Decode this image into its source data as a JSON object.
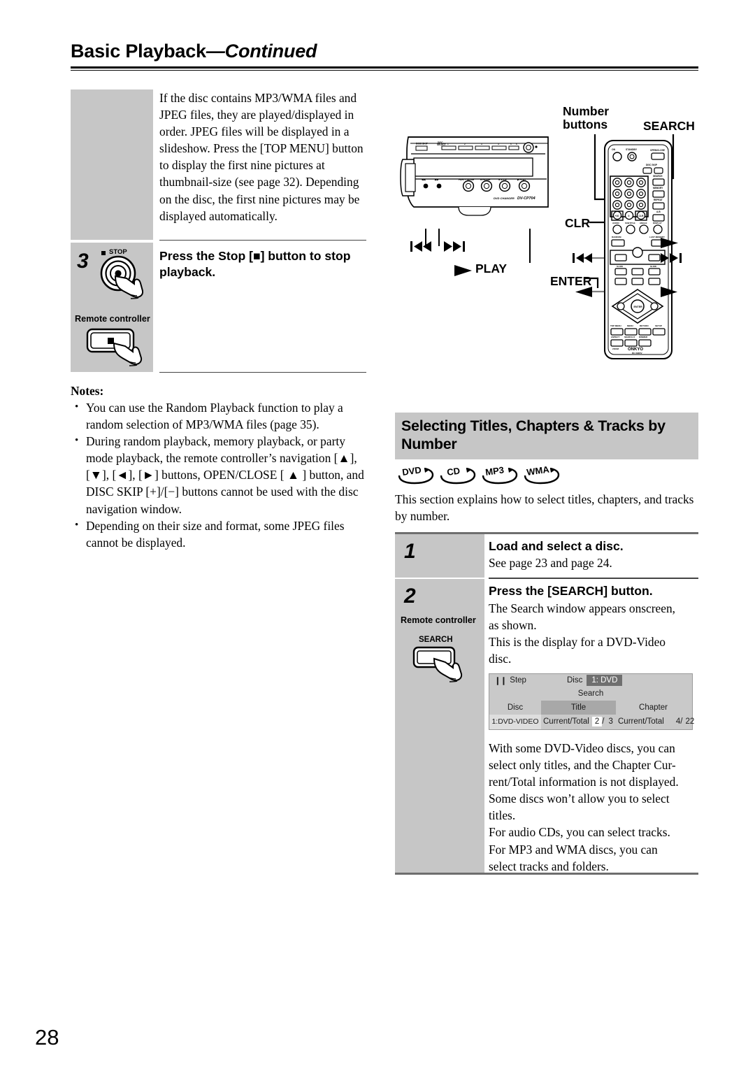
{
  "header": {
    "title_main": "Basic Playback",
    "title_dash": "—",
    "title_cont": "Continued"
  },
  "left_column": {
    "intro_paragraph": "If the disc contains MP3/WMA files and JPEG files, they are played/displayed in order. JPEG files will be displayed in a slideshow. Press the [TOP MENU] button to display the first nine pictures at thumbnail-size (see page 32). Depending on the disc, the first nine pictures may be displayed automatically.",
    "step": {
      "number": "3",
      "instruction": "Press the Stop [■] button to stop playback.",
      "panel_button_caption": "STOP",
      "remote_label": "Remote controller"
    },
    "notes": {
      "heading": "Notes:",
      "items": [
        "You can use the Random Playback function to play a random selection of MP3/WMA files (page 35).",
        "During random playback, memory playback, or party mode playback, the remote controller’s navigation [▲], [▼], [◄], [►] buttons, OPEN/CLOSE [ ▲ ] button, and DISC SKIP [+]/[−] buttons cannot be used with the disc navigation window.",
        "Depending on their size and format, some JPEG files cannot be displayed."
      ]
    }
  },
  "diagram": {
    "callouts": {
      "number_buttons": "Number\nbuttons",
      "number_buttons_l1": "Number",
      "number_buttons_l2": "buttons",
      "search": "SEARCH",
      "clr": "CLR",
      "enter": "ENTER",
      "play": "PLAY"
    },
    "device": {
      "brand_line": "DVD CHANGER",
      "model": "DV-CP704",
      "disc_skip_label": "DISC SKIP",
      "disc_select_label": "DISC SELECT",
      "transport_labels": [
        "PARTY MODE",
        "PAUSE",
        "STOP",
        "PLAY"
      ],
      "disc_numbers": [
        "1",
        "2",
        "3",
        "4",
        "5",
        "6"
      ]
    },
    "remote": {
      "brand": "ONKYO",
      "model": "RC-592DV",
      "top_labels": [
        "ON",
        "STANDBY",
        "OPEN/CLOSE"
      ],
      "disc_skip": "DISC SKIP",
      "side_labels": [
        "SEARCH",
        "MEMORY",
        "REPEAT",
        "A-B"
      ],
      "row_labels": [
        "AUDIO",
        "SUBTITLE",
        "ANGLE",
        "DISPLAY"
      ],
      "fn_labels": [
        "RANDOM",
        "LAST MEMORY"
      ],
      "slow_labels": [
        "SLOW",
        "SLOW"
      ],
      "menu_labels": [
        "TOP MENU",
        "MENU",
        "RETURN",
        "SETUP"
      ],
      "bottom_labels": [
        "ASPECT",
        "SEARCH 2",
        "DIMMER"
      ],
      "zoom_label": "ZOOM",
      "enter_label": "ENTER"
    },
    "arrow_labels": {
      "prev": "❘◄◄",
      "next": "►►❘",
      "play_tri": "►",
      "left_tri": "◄"
    }
  },
  "right_column": {
    "section_title_line1": "Selecting Titles, Chapters & Tracks by",
    "section_title_line2": "Number",
    "badges": [
      "DVD",
      "CD",
      "MP3",
      "WMA"
    ],
    "section_intro": "This section explains how to select titles, chapters, and tracks by number.",
    "steps": [
      {
        "number": "1",
        "instruction": "Load and select a disc.",
        "body": "See page 23 and page 24."
      },
      {
        "number": "2",
        "instruction": "Press the [SEARCH] button.",
        "body_lines": [
          "The Search window appears onscreen,",
          "as shown.",
          "This is the display for a DVD-Video",
          "disc."
        ],
        "remote_label": "Remote controller",
        "button_caption": "SEARCH"
      }
    ],
    "osd": {
      "step_label": "Step",
      "pause_glyph": "❙❙",
      "disc_label": "Disc",
      "disc_value": "1: DVD",
      "search_label": "Search",
      "col_headers": [
        "Disc",
        "Title",
        "Chapter"
      ],
      "disc_type": "1:DVD-VIDEO",
      "title_ct_label": "Current/Total",
      "title_current": "2",
      "title_sep": "/",
      "title_total": "3",
      "chapter_ct_label": "Current/Total",
      "chapter_current": "4",
      "chapter_sep": "/",
      "chapter_total": "22"
    },
    "closing_paragraph_lines": [
      "With some DVD-Video discs, you can",
      "select only titles, and the Chapter Cur-",
      "rent/Total information is not displayed.",
      "Some discs won’t allow you to select",
      "titles.",
      "For audio CDs, you can select tracks.",
      "For MP3 and WMA discs, you can",
      "select tracks and folders."
    ]
  },
  "footer": {
    "page_number": "28"
  },
  "colors": {
    "gray_band": "#c6c6c6",
    "rule": "#444444",
    "osd_dark": "#6f6f6f",
    "osd_mid": "#a8a8a8",
    "osd_light": "#dedede"
  }
}
